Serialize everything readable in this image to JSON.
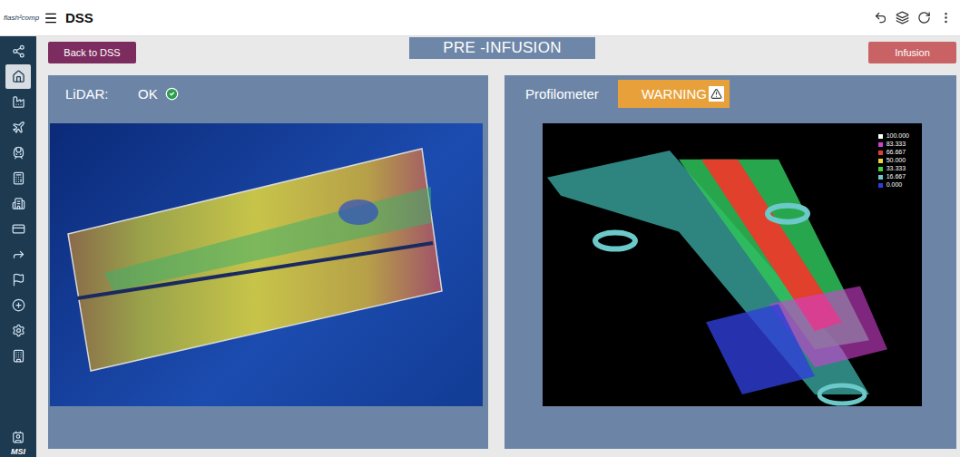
{
  "header": {
    "logo": "flash²comp",
    "title": "DSS"
  },
  "sidebar": {
    "items": [
      {
        "selected": false
      },
      {
        "selected": true
      },
      {
        "selected": false
      },
      {
        "selected": false
      },
      {
        "selected": false
      },
      {
        "selected": false
      },
      {
        "selected": false
      },
      {
        "selected": false
      },
      {
        "selected": false
      },
      {
        "selected": false
      },
      {
        "selected": false
      },
      {
        "selected": false
      },
      {
        "selected": false
      }
    ],
    "footer_logo": "MSI"
  },
  "toolbar": {
    "back_button": "Back to DSS",
    "title": "PRE -INFUSION",
    "next_button": "Infusion"
  },
  "panels": [
    {
      "label": "LiDAR:",
      "status": "OK",
      "ok": true,
      "kind": "lidar"
    },
    {
      "label": "Profilometer",
      "status": "WARNING",
      "ok": false,
      "kind": "profile",
      "legend": [
        {
          "label": "100.000",
          "color": "#ffffff"
        },
        {
          "label": "83.333",
          "color": "#d43fd4"
        },
        {
          "label": "66.667",
          "color": "#e0402c"
        },
        {
          "label": "50.000",
          "color": "#e6d83c"
        },
        {
          "label": "33.333",
          "color": "#3fd63f"
        },
        {
          "label": "16.667",
          "color": "#6cc9c9"
        },
        {
          "label": "0.000",
          "color": "#2f3ed8"
        }
      ]
    }
  ]
}
